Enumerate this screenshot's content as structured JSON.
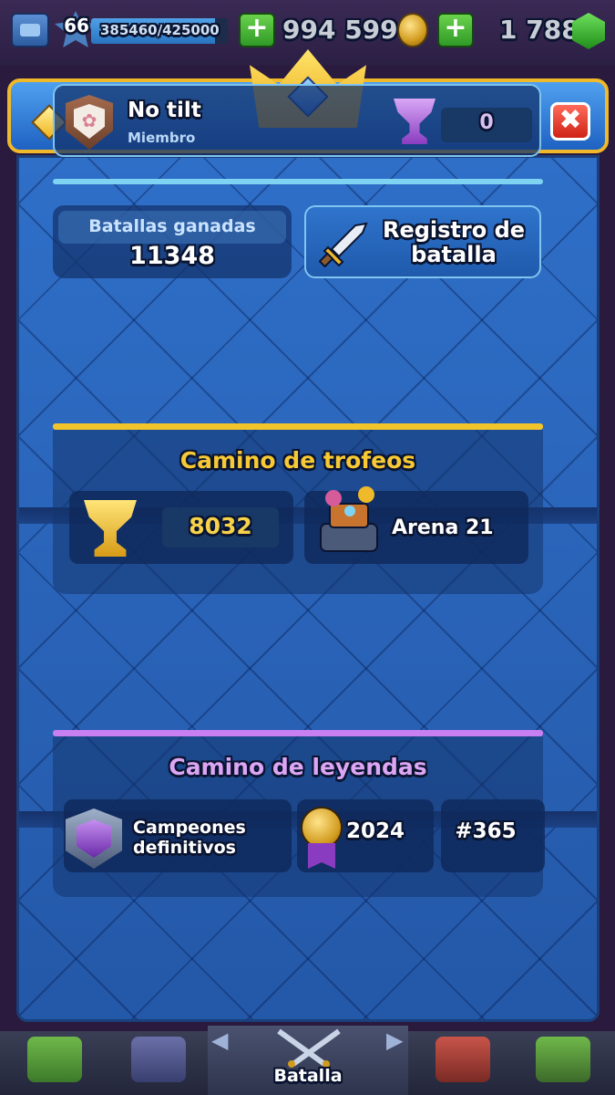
{
  "topbar": {
    "level": "66",
    "xp_text": "385460/425000",
    "xp_progress": 0.907,
    "gold": "994 599",
    "gems": "1 788",
    "plus_label": "+"
  },
  "modal": {
    "close_label": "✖",
    "clan": {
      "name": "No tilt",
      "role": "Miembro",
      "trophies": "0"
    },
    "battles": {
      "label": "Batallas ganadas",
      "value": "11348"
    },
    "battle_log": {
      "label": "Registro de batalla"
    },
    "trophy_road": {
      "title": "Camino de trofeos",
      "trophies": "8032",
      "arena": "Arena 21"
    },
    "legends_path": {
      "title": "Camino de leyendas",
      "rank_name": "Campeones definitivos",
      "season": "2024",
      "position": "#365"
    }
  },
  "bottom_nav": {
    "active_label": "Batalla",
    "tabs": [
      "shop-icon",
      "cards-icon",
      "battle-icon",
      "clan-icon",
      "events-icon"
    ]
  },
  "colors": {
    "accent_gold": "#f2c42b",
    "accent_purple": "#c87ff2",
    "accent_cyan": "#7fd3f2",
    "close_red": "#cf2316"
  }
}
